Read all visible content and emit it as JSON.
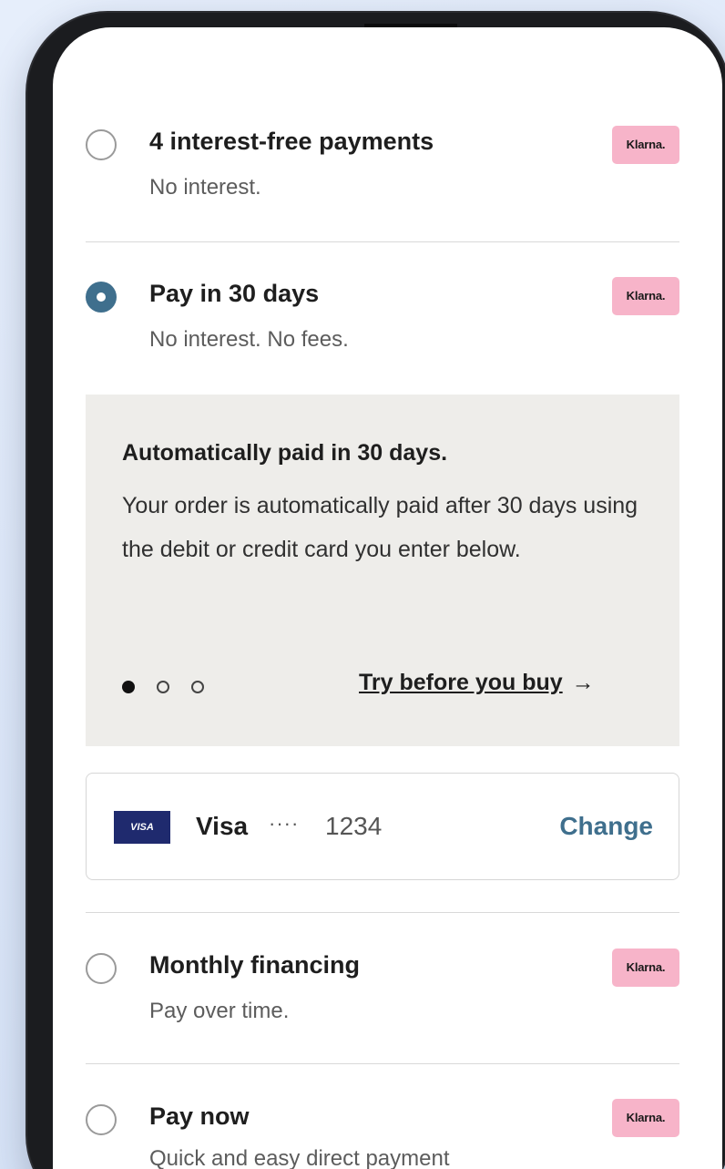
{
  "options": [
    {
      "title": "4 interest-free payments",
      "subtitle": "No interest.",
      "badge": "Klarna.",
      "selected": false
    },
    {
      "title": "Pay in 30 days",
      "subtitle": "No interest. No fees.",
      "badge": "Klarna.",
      "selected": true
    },
    {
      "title": "Monthly financing",
      "subtitle": "Pay over time.",
      "badge": "Klarna.",
      "selected": false
    },
    {
      "title": "Pay now",
      "subtitle": "Quick and easy direct payment",
      "badge": "Klarna.",
      "selected": false
    }
  ],
  "info_panel": {
    "title": "Automatically paid in 30 days.",
    "body": "Your order is automatically paid after 30 days using the debit or credit card you enter below.",
    "carousel_active_index": 0,
    "carousel_count": 3,
    "link_label": "Try before you buy",
    "link_arrow": "→"
  },
  "card": {
    "logo_text": "VISA",
    "brand": "Visa",
    "masked": "····",
    "last4": "1234",
    "change_label": "Change"
  },
  "colors": {
    "accent": "#3f6f8d",
    "klarna_pink": "#f7b4c9",
    "panel_bg": "#eeedea",
    "visa_blue": "#1f2a6e",
    "background": "#dde7f8"
  },
  "icons": {
    "arrow": "arrow-right-icon",
    "card_logo": "visa-logo-icon"
  }
}
